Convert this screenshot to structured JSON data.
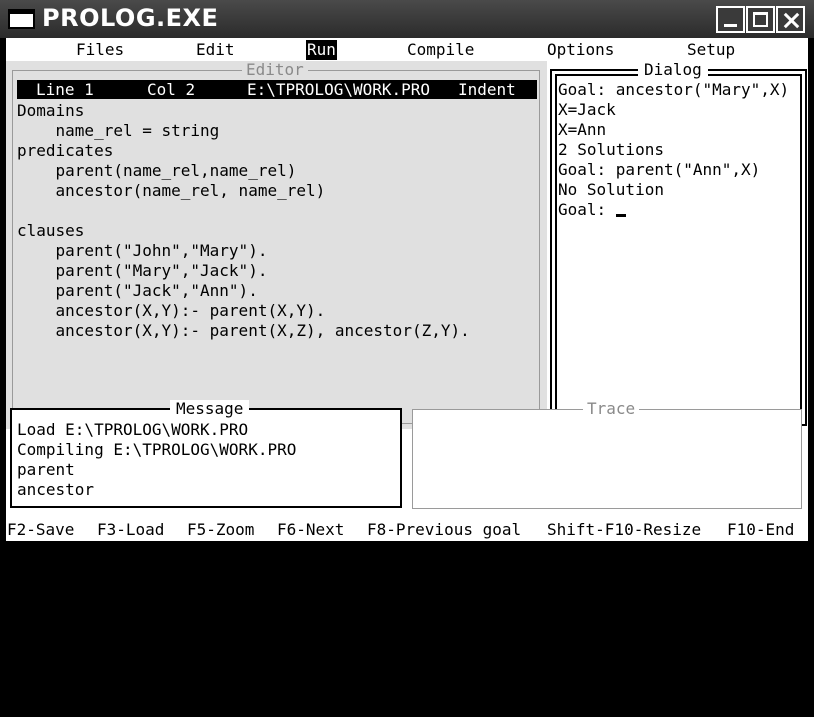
{
  "window": {
    "title": "PROLOG.EXE",
    "icon_text": "C:\\_"
  },
  "menu": [
    {
      "label": "Files",
      "active": false
    },
    {
      "label": "Edit",
      "active": false
    },
    {
      "label": "Run",
      "active": true
    },
    {
      "label": "Compile",
      "active": false
    },
    {
      "label": "Options",
      "active": false
    },
    {
      "label": "Setup",
      "active": false
    }
  ],
  "editor": {
    "title": "Editor",
    "status": {
      "line": "Line 1",
      "col": "Col 2",
      "file": "E:\\TPROLOG\\WORK.PRO",
      "mode": "Indent"
    },
    "lines": [
      "Domains",
      "    name_rel = string",
      "predicates",
      "    parent(name_rel,name_rel)",
      "    ancestor(name_rel, name_rel)",
      "",
      "clauses",
      "    parent(\"John\",\"Mary\").",
      "    parent(\"Mary\",\"Jack\").",
      "    parent(\"Jack\",\"Ann\").",
      "    ancestor(X,Y):- parent(X,Y).",
      "    ancestor(X,Y):- parent(X,Z), ancestor(Z,Y)."
    ]
  },
  "dialog": {
    "title": "Dialog",
    "lines": [
      "Goal: ancestor(\"Mary\",X)",
      "X=Jack",
      "X=Ann",
      "2 Solutions",
      "Goal: parent(\"Ann\",X)",
      "No Solution",
      "Goal: "
    ]
  },
  "message": {
    "title": "Message",
    "lines": [
      "Load E:\\TPROLOG\\WORK.PRO",
      "Compiling E:\\TPROLOG\\WORK.PRO",
      "parent",
      "ancestor"
    ]
  },
  "trace": {
    "title": "Trace"
  },
  "fkeys": [
    "F2-Save",
    "F3-Load",
    "F5-Zoom",
    "F6-Next",
    "F8-Previous goal",
    "Shift-F10-Resize",
    "F10-End"
  ]
}
